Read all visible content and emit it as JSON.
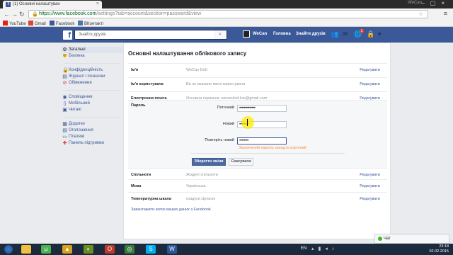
{
  "browser": {
    "tab_title": "(1) Основні налаштуван",
    "user_name": "WeCan",
    "url_host": "https://www.facebook.com",
    "url_path": "/settings?tab=account&section=password&view",
    "bookmarks": [
      {
        "label": "YouTube",
        "color": "#e62117"
      },
      {
        "label": "Gmail",
        "color": "#d44638"
      },
      {
        "label": "Facebook",
        "color": "#3b5998"
      },
      {
        "label": "ВКонтакті",
        "color": "#4a76a8"
      }
    ]
  },
  "fb_header": {
    "logo": "f",
    "search_placeholder": "Знайти друзів",
    "user": "WeCan",
    "home": "Головна",
    "find_friends": "Знайти друзів",
    "notif_count": "1",
    "brand_color": "#3b5998"
  },
  "sidebar": {
    "items": [
      {
        "label": "Загальні",
        "icon": "gear-icon",
        "glyph": "⚙",
        "active": true
      },
      {
        "label": "Безпека",
        "icon": "shield-icon",
        "glyph": "⛊",
        "active": false
      },
      {
        "label": "Конфіденційність",
        "icon": "lock-icon",
        "glyph": "🔒",
        "active": false
      },
      {
        "label": "Журнал і позначки",
        "icon": "tag-icon",
        "glyph": "▤",
        "active": false
      },
      {
        "label": "Обмеження",
        "icon": "block-icon",
        "glyph": "⊘",
        "active": false
      },
      {
        "label": "Сповіщення",
        "icon": "globe-icon",
        "glyph": "◉",
        "active": false
      },
      {
        "label": "Мобільний",
        "icon": "mobile-icon",
        "glyph": "▯",
        "active": false
      },
      {
        "label": "Читачі",
        "icon": "rss-icon",
        "glyph": "▣",
        "active": false
      },
      {
        "label": "Додатки",
        "icon": "apps-icon",
        "glyph": "▦",
        "active": false
      },
      {
        "label": "Оголошення",
        "icon": "ads-icon",
        "glyph": "▤",
        "active": false
      },
      {
        "label": "Платежі",
        "icon": "card-icon",
        "glyph": "▭",
        "active": false
      },
      {
        "label": "Панель підтримки",
        "icon": "lifebuoy-icon",
        "glyph": "✚",
        "active": false
      }
    ]
  },
  "main": {
    "title": "Основні налаштування облікового запису",
    "rows_top": [
      {
        "label": "Ім'я",
        "value": "WeCan DoIt",
        "edit": "Редагувати"
      },
      {
        "label": "Ім'я користувача",
        "value": "Ви не вказали імені користувача",
        "edit": "Редагувати"
      },
      {
        "label": "Електронна пошта",
        "value": "Основна скринька: wecandoit.lviv@gmail.com",
        "edit": "Редагувати"
      }
    ],
    "password": {
      "label": "Пароль",
      "current_label": "Поточний",
      "current_value": "••••••••••••••",
      "new_label": "Новий",
      "new_value": "••••••••",
      "repeat_label": "Повторіть новий",
      "repeat_value": "••••••••",
      "hint": "Зазначений пароль занадто короткий",
      "save": "Зберегти зміни",
      "cancel": "Скасувати"
    },
    "rows_bottom": [
      {
        "label": "Спільноти",
        "value": "Жодної спільноти",
        "edit": "Редагувати"
      },
      {
        "label": "Мова",
        "value": "Українська",
        "edit": "Редагувати"
      },
      {
        "label": "Температурна шкала",
        "value": "градуси Цельсія",
        "edit": "Редагувати"
      }
    ],
    "download": "Завантажити копію ваших даних з Facebook."
  },
  "chat": {
    "label": "Чат"
  },
  "taskbar": {
    "lang": "EN",
    "time": "23:18",
    "date": "02.02.2015"
  }
}
